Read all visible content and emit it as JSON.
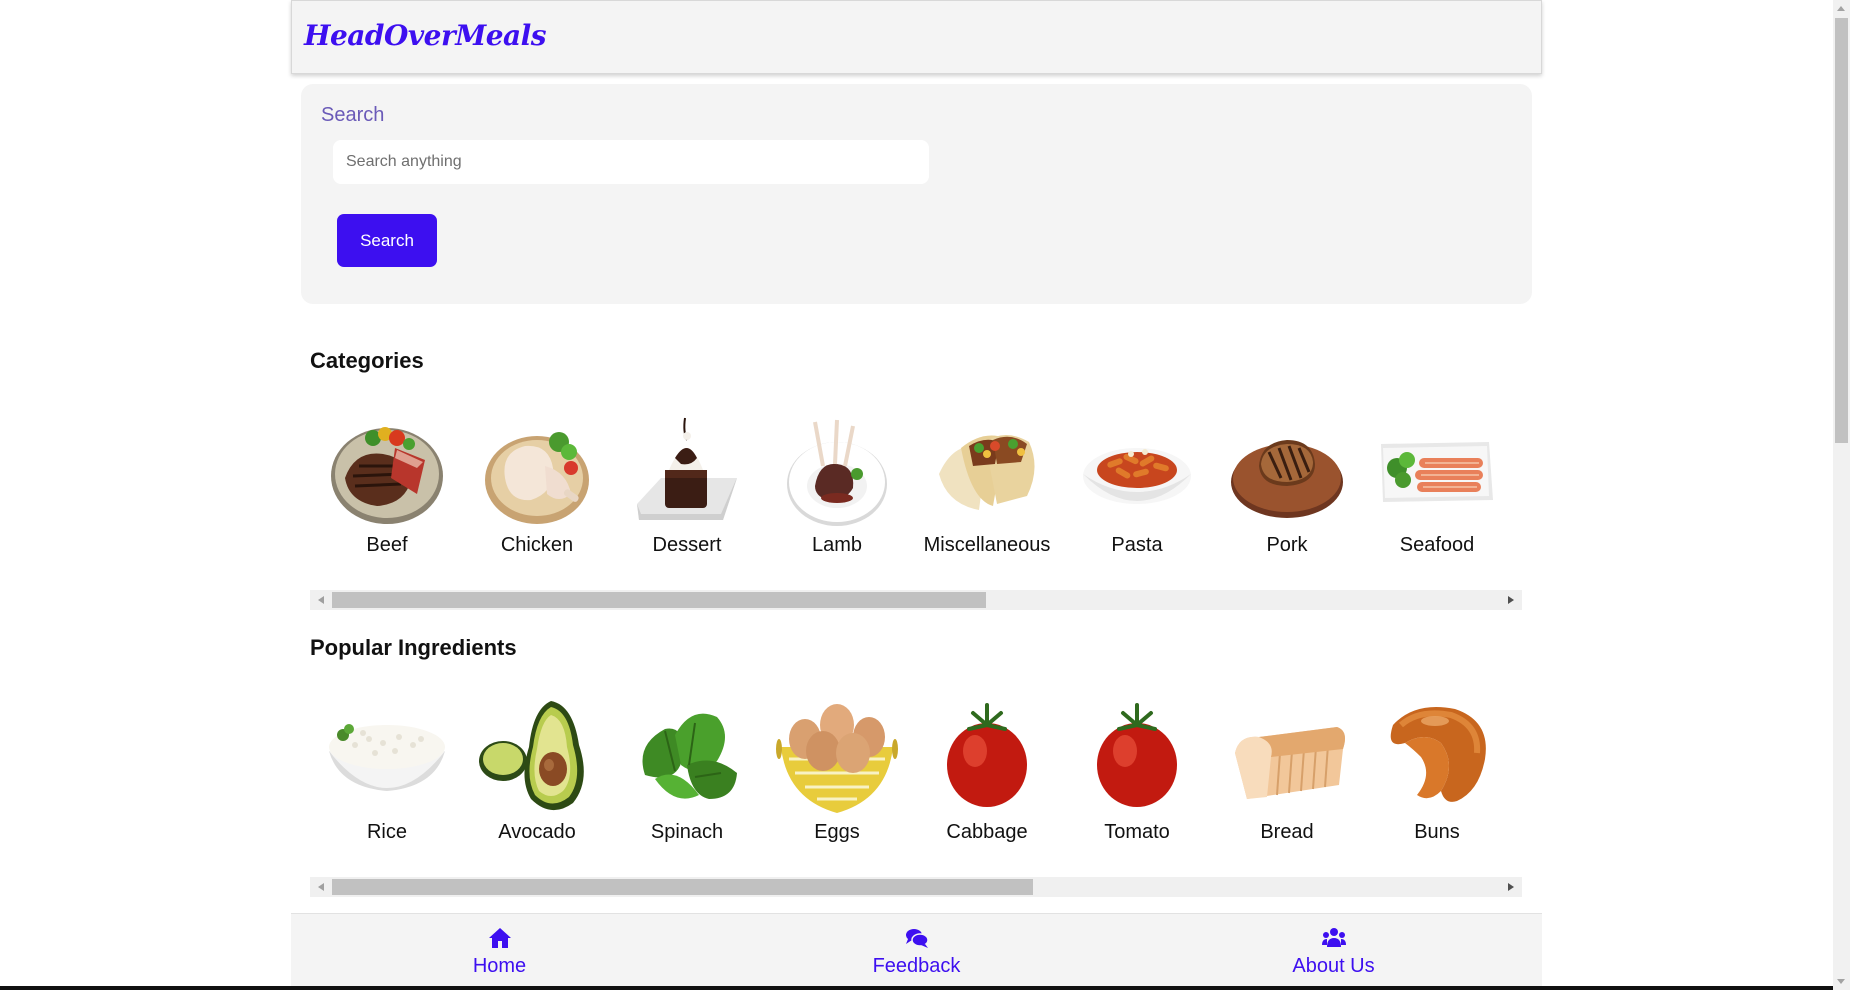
{
  "app": {
    "logo": "HeadOverMeals",
    "brand_color": "#3d0ff0"
  },
  "search": {
    "label": "Search",
    "placeholder": "Search anything",
    "value": "",
    "button_label": "Search"
  },
  "categories": {
    "title": "Categories",
    "items": [
      {
        "label": "Beef",
        "icon": "beef-steak-image"
      },
      {
        "label": "Chicken",
        "icon": "chicken-leg-image"
      },
      {
        "label": "Dessert",
        "icon": "chocolate-dessert-image"
      },
      {
        "label": "Lamb",
        "icon": "lamb-chops-image"
      },
      {
        "label": "Miscellaneous",
        "icon": "tacos-image"
      },
      {
        "label": "Pasta",
        "icon": "penne-pasta-image"
      },
      {
        "label": "Pork",
        "icon": "pork-chop-image"
      },
      {
        "label": "Seafood",
        "icon": "salmon-plate-image"
      }
    ],
    "scroll_position": 0,
    "scroll_visible_fraction": 0.56
  },
  "ingredients": {
    "title": "Popular Ingredients",
    "items": [
      {
        "label": "Rice",
        "icon": "rice-bowl-image"
      },
      {
        "label": "Avocado",
        "icon": "avocado-image"
      },
      {
        "label": "Spinach",
        "icon": "spinach-image"
      },
      {
        "label": "Eggs",
        "icon": "egg-basket-image"
      },
      {
        "label": "Cabbage",
        "icon": "tomato-image"
      },
      {
        "label": "Tomato",
        "icon": "tomato-image"
      },
      {
        "label": "Bread",
        "icon": "bread-loaf-image"
      },
      {
        "label": "Buns",
        "icon": "bun-image"
      }
    ],
    "scroll_position": 0,
    "scroll_visible_fraction": 0.6
  },
  "nav": {
    "items": [
      {
        "label": "Home",
        "icon": "home-icon"
      },
      {
        "label": "Feedback",
        "icon": "comments-icon"
      },
      {
        "label": "About Us",
        "icon": "users-icon"
      }
    ]
  }
}
